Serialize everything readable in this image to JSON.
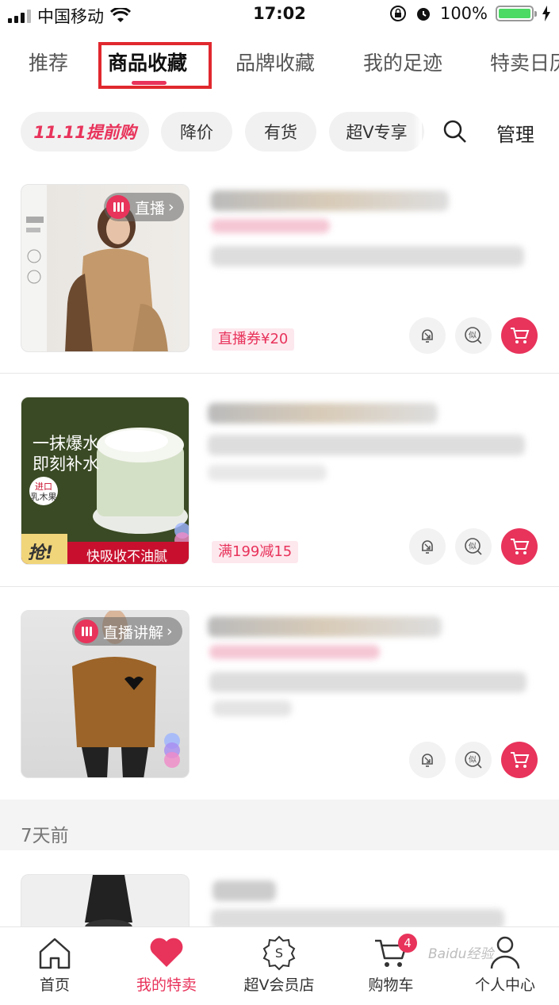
{
  "status_bar": {
    "carrier": "中国移动",
    "time": "17:02",
    "battery": "100%"
  },
  "top_tabs": [
    {
      "label": "推荐"
    },
    {
      "label": "商品收藏"
    },
    {
      "label": "品牌收藏"
    },
    {
      "label": "我的足迹"
    },
    {
      "label": "特卖日历"
    }
  ],
  "filters": {
    "promo": "11.11提前购",
    "price_drop": "降价",
    "in_stock": "有货",
    "super_v": "超V专享",
    "manage": "管理"
  },
  "products": [
    {
      "live_label": "直播",
      "coupon": "直播券¥20"
    },
    {
      "promo_text_1": "一抹爆水",
      "promo_text_2": "即刻补水",
      "tag_line1": "进口",
      "tag_line2": "乳木果",
      "grab": "抢!",
      "slogan": "快吸收不油腻",
      "coupon": "满199减15"
    },
    {
      "live_label": "直播讲解"
    }
  ],
  "section_header": "7天前",
  "bottom_nav": [
    {
      "label": "首页"
    },
    {
      "label": "我的特卖"
    },
    {
      "label": "超V会员店"
    },
    {
      "label": "购物车",
      "badge": "4"
    },
    {
      "label": "个人中心"
    }
  ],
  "watermark": "Baidu经验",
  "colors": {
    "accent": "#e8335b",
    "highlight_box": "#e0282e"
  }
}
